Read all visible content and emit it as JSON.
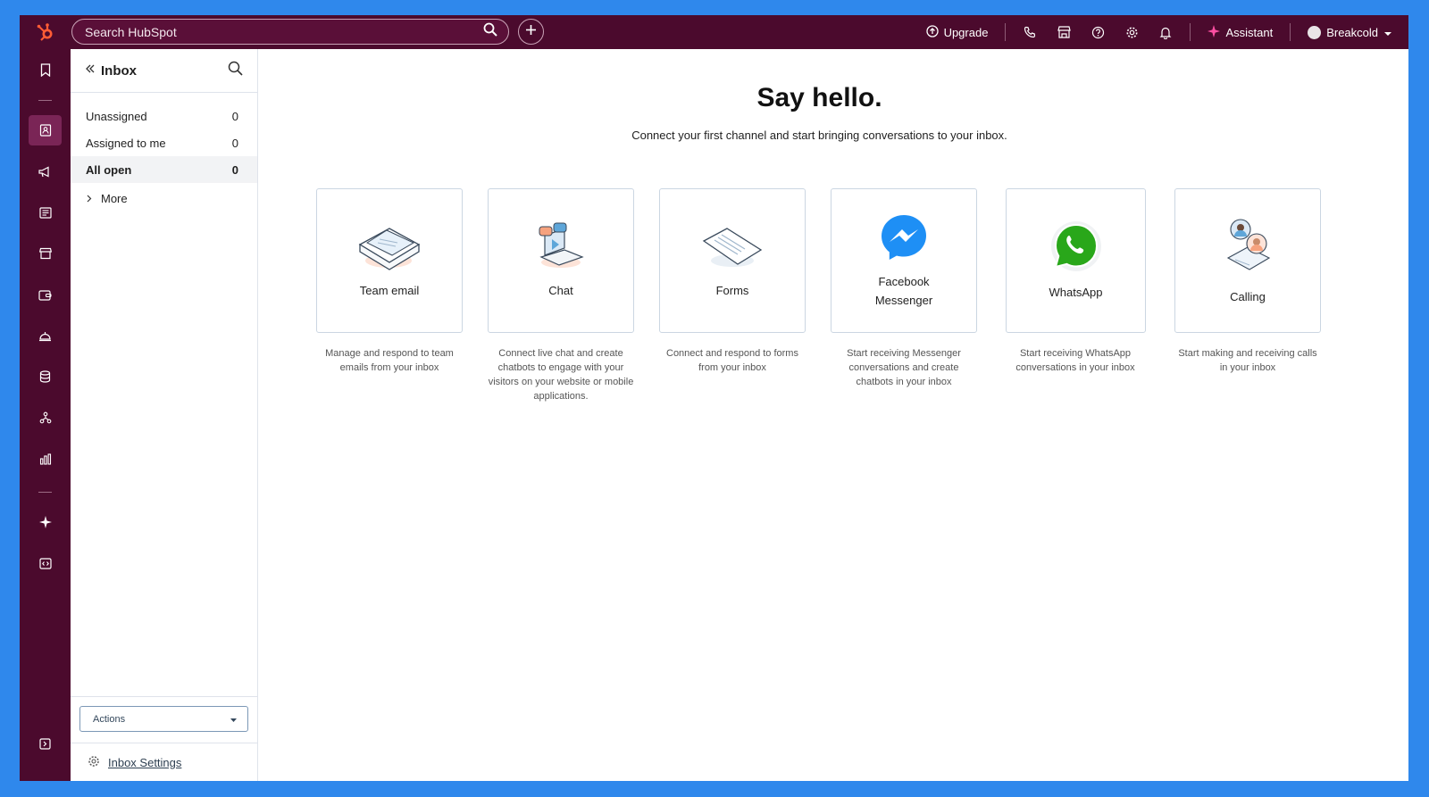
{
  "topbar": {
    "search_placeholder": "Search HubSpot",
    "upgrade_label": "Upgrade",
    "assistant_label": "Assistant",
    "account_label": "Breakcold"
  },
  "sidebar": {
    "title": "Inbox",
    "items": [
      {
        "label": "Unassigned",
        "count": "0"
      },
      {
        "label": "Assigned to me",
        "count": "0"
      },
      {
        "label": "All open",
        "count": "0"
      }
    ],
    "more_label": "More",
    "actions_label": "Actions",
    "settings_label": "Inbox Settings"
  },
  "main": {
    "heading": "Say hello.",
    "subheading": "Connect your first channel and start bringing conversations to your inbox.",
    "channels": [
      {
        "label": "Team email",
        "desc": "Manage and respond to team emails from your inbox"
      },
      {
        "label": "Chat",
        "desc": "Connect live chat and create chatbots to engage with your visitors on your website or mobile applications."
      },
      {
        "label": "Forms",
        "desc": "Connect and respond to forms from your inbox"
      },
      {
        "label": "Facebook Messenger",
        "desc": "Start receiving Messenger conversations and create chatbots in your inbox"
      },
      {
        "label": "WhatsApp",
        "desc": "Start receiving WhatsApp conversations in your inbox"
      },
      {
        "label": "Calling",
        "desc": "Start making and receiving calls in your inbox"
      }
    ]
  },
  "colors": {
    "nav_bg": "#4b0a2d",
    "frame_bg": "#2f88ec",
    "brand_orange": "#ff5c35",
    "messenger_blue": "#1e8ff5",
    "whatsapp_green": "#29a71a"
  }
}
